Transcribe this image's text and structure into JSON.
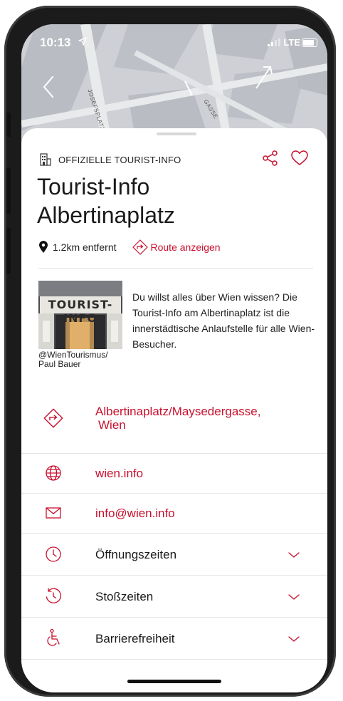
{
  "status_bar": {
    "time": "10:13",
    "network": "LTE"
  },
  "map": {
    "street_1": "JOSEFSPLATZ",
    "street_2": "GASSE"
  },
  "header": {
    "category": "OFFIZIELLE TOURIST-INFO",
    "title_line1": "Tourist-Info",
    "title_line2": "Albertinaplatz",
    "distance": "1.2km entfernt",
    "route_label": "Route anzeigen"
  },
  "photo": {
    "sign_text": "TOURIST-INFO",
    "credit_line1": "@WienTourismus/",
    "credit_line2": "Paul Bauer"
  },
  "description": "Du willst alles über Wien wissen? Die Tourist-Info am Albertinaplatz ist die innerstädtische Anlaufstelle für alle Wien-Besucher.",
  "details": {
    "address_line1": "Albertinaplatz/Maysedergasse,",
    "address_line2": "Wien",
    "website": "wien.info",
    "email": "info@wien.info",
    "opening_hours": "Öffnungszeiten",
    "peak_times": "Stoßzeiten",
    "accessibility": "Barrierefreiheit"
  },
  "colors": {
    "accent": "#c8102e",
    "text": "#1a1a1a",
    "divider": "#e6e6e6"
  }
}
